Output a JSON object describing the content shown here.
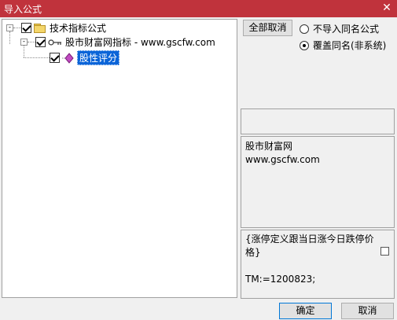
{
  "window": {
    "title": "导入公式",
    "close_glyph": "✕"
  },
  "tree": {
    "root": {
      "label": "技术指标公式",
      "checked": true,
      "expander": "-"
    },
    "group": {
      "label": "股市财富网指标 - www.gscfw.com",
      "checked": true,
      "expander": "-"
    },
    "item": {
      "label": "股性评分",
      "checked": true,
      "selected": true
    }
  },
  "controls": {
    "cancel_all_label": "全部取消",
    "options": [
      {
        "label": "不导入同名公式",
        "checked": false
      },
      {
        "label": "覆盖同名(非系统)",
        "checked": true
      }
    ]
  },
  "info_panel": {
    "text": "股市财富网\nwww.gscfw.com"
  },
  "code_panel": {
    "text": "{涨停定义跟当日涨今日跌停价\n格}\n\nTM:=1200823;"
  },
  "footer": {
    "ok_label": "确定",
    "cancel_label": "取消"
  }
}
